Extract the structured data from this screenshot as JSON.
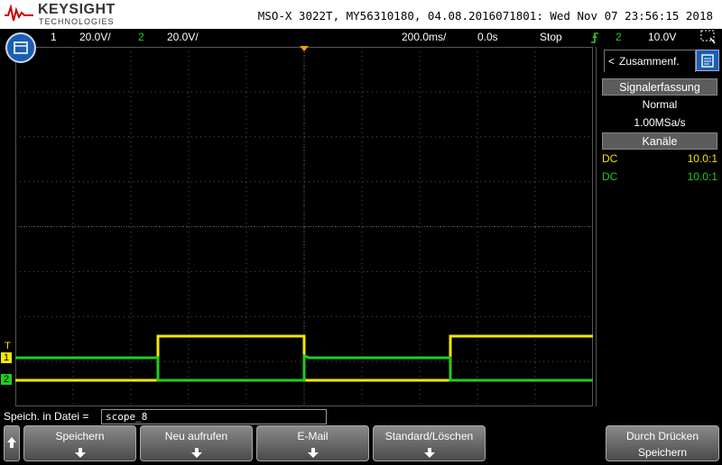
{
  "header": {
    "brand": "KEYSIGHT",
    "brand_sub": "TECHNOLOGIES",
    "instrument_info": "MSO-X 3022T, MY56310180, 04.08.2016071801: Wed Nov 07 23:56:15 2018"
  },
  "statusbar": {
    "ch1_num": "1",
    "ch1_scale": "20.0V/",
    "ch2_num": "2",
    "ch2_scale": "20.0V/",
    "timebase": "200.0ms/",
    "delay": "0.0s",
    "run_state": "Stop",
    "trigger_source": "2",
    "trigger_level": "10.0V"
  },
  "colors": {
    "ch1": "#f5e600",
    "ch2": "#22cc22",
    "grid": "#555555",
    "accent": "#1a5fb4"
  },
  "channel_markers": {
    "ch1_label": "1",
    "ch2_label": "2",
    "trigger_label": "T"
  },
  "side_panel": {
    "tab_label": "Zusammenf.",
    "acq_header": "Signalerfassung",
    "acq_mode": "Normal",
    "sample_rate": "1.00MSa/s",
    "channels_header": "Kanäle",
    "channels": [
      {
        "coupling": "DC",
        "probe": "10.0:1"
      },
      {
        "coupling": "DC",
        "probe": "10.0:1"
      }
    ]
  },
  "save": {
    "label": "Speich. in Datei =",
    "filename": "scope_8"
  },
  "softkeys": [
    {
      "label": "Speichern"
    },
    {
      "label": "Neu aufrufen"
    },
    {
      "label": "E-Mail"
    },
    {
      "label": "Standard/Löschen"
    },
    {
      "label": "Durch Drücken",
      "label2": "Speichern"
    }
  ],
  "icons": [
    "keysight-logo-icon",
    "menu-icon",
    "trigger-edge-icon",
    "display-icon",
    "panel-icon",
    "up-arrow-icon",
    "down-arrow-icon"
  ]
}
